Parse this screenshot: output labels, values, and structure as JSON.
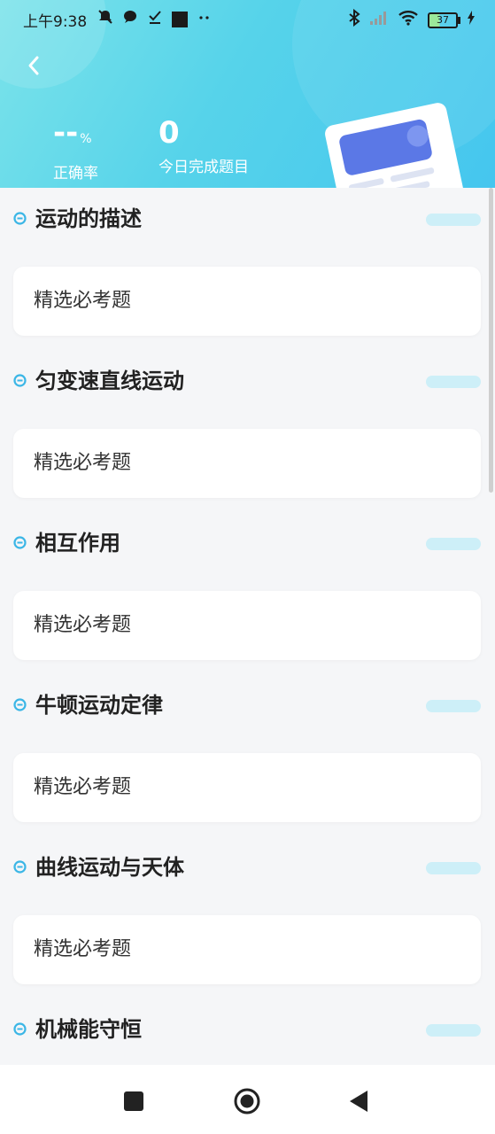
{
  "status_bar": {
    "time": "上午9:38",
    "battery": "37"
  },
  "header": {
    "accuracy_value": "--",
    "accuracy_unit": "%",
    "accuracy_label": "正确率",
    "done_value": "0",
    "done_label": "今日完成题目"
  },
  "sections": [
    {
      "title": "运动的描述",
      "card_label": "精选必考题"
    },
    {
      "title": "匀变速直线运动",
      "card_label": "精选必考题"
    },
    {
      "title": "相互作用",
      "card_label": "精选必考题"
    },
    {
      "title": "牛顿运动定律",
      "card_label": "精选必考题"
    },
    {
      "title": "曲线运动与天体",
      "card_label": "精选必考题"
    },
    {
      "title": "机械能守恒",
      "card_label": ""
    }
  ],
  "colors": {
    "accent": "#45c6ee",
    "section_dot": "#3bb6e6",
    "pill": "#cdeff8"
  }
}
